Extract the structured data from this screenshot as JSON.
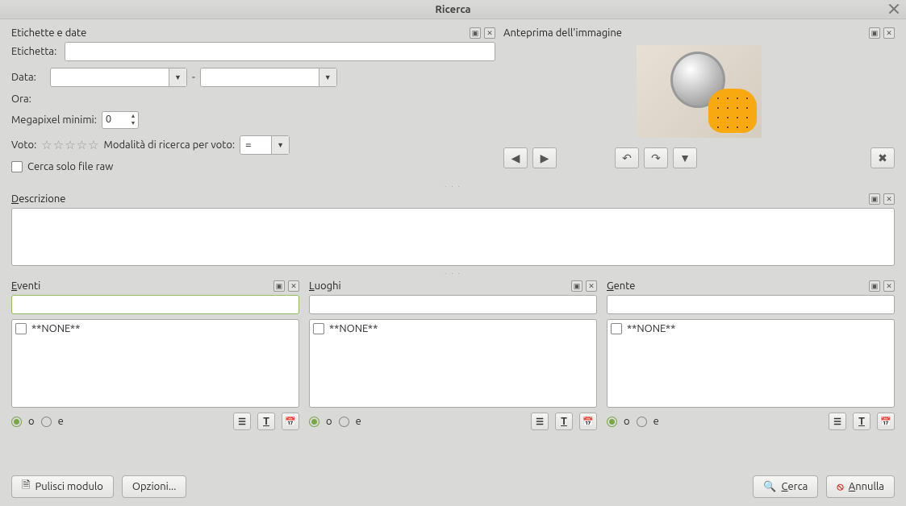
{
  "window": {
    "title": "Ricerca"
  },
  "tags_panel": {
    "title": "Etichette e date",
    "label_tag": "Etichetta:",
    "label_date": "Data:",
    "date_from": "",
    "date_to": "",
    "date_sep": "-",
    "label_time": "Ora:",
    "label_megapixels": "Megapixel minimi:",
    "megapixels": "0",
    "label_vote": "Voto:",
    "label_vote_mode": "Modalità di ricerca per voto:",
    "vote_mode": "=",
    "raw_only": "Cerca solo file raw"
  },
  "preview": {
    "title": "Anteprima dell'immagine"
  },
  "desc": {
    "title": "Descrizione",
    "text": ""
  },
  "cols": {
    "lists": [
      {
        "title": "Eventi",
        "filter": "",
        "none": "**NONE**",
        "o": "o",
        "e": "e"
      },
      {
        "title": "Luoghi",
        "filter": "",
        "none": "**NONE**",
        "o": "o",
        "e": "e"
      },
      {
        "title": "Gente",
        "filter": "",
        "none": "**NONE**",
        "o": "o",
        "e": "e"
      }
    ]
  },
  "buttons": {
    "clear": "Pulisci modulo",
    "options": "Opzioni...",
    "search": "Cerca",
    "cancel": "Annulla"
  }
}
